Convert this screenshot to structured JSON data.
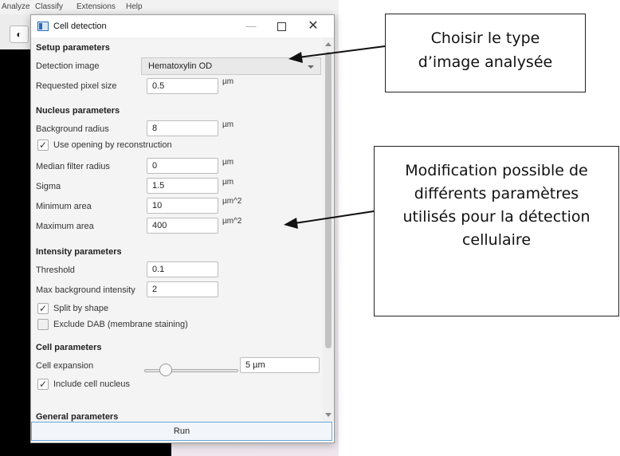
{
  "app": {
    "menu": [
      "Analyze",
      "Classify",
      "Extensions",
      "Help"
    ],
    "toolbar_icon": "contrast-icon"
  },
  "dialog": {
    "title": "Cell detection",
    "controls": {
      "minimize": "—",
      "close": "✕"
    },
    "setup": {
      "heading": "Setup parameters",
      "detection_image_label": "Detection image",
      "detection_image_value": "Hematoxylin OD",
      "pixel_size_label": "Requested pixel size",
      "pixel_size_value": "0.5",
      "pixel_size_unit": "µm"
    },
    "nucleus": {
      "heading": "Nucleus parameters",
      "background_radius_label": "Background radius",
      "background_radius_value": "8",
      "background_radius_unit": "µm",
      "opening_label": "Use opening by reconstruction",
      "opening_checked": true,
      "median_label": "Median filter radius",
      "median_value": "0",
      "median_unit": "µm",
      "sigma_label": "Sigma",
      "sigma_value": "1.5",
      "sigma_unit": "µm",
      "min_area_label": "Minimum area",
      "min_area_value": "10",
      "min_area_unit": "µm^2",
      "max_area_label": "Maximum area",
      "max_area_value": "400",
      "max_area_unit": "µm^2"
    },
    "intensity": {
      "heading": "Intensity parameters",
      "threshold_label": "Threshold",
      "threshold_value": "0.1",
      "max_bg_label": "Max background intensity",
      "max_bg_value": "2",
      "split_label": "Split by shape",
      "split_checked": true,
      "exclude_dab_label": "Exclude DAB (membrane staining)",
      "exclude_dab_checked": false
    },
    "cell": {
      "heading": "Cell parameters",
      "expansion_label": "Cell expansion",
      "expansion_value": "5 µm",
      "expansion_fraction": 0.16,
      "include_nucleus_label": "Include cell nucleus",
      "include_nucleus_checked": true
    },
    "general": {
      "heading": "General parameters"
    },
    "run_label": "Run"
  },
  "annotations": {
    "callout1_lines": [
      "Choisir le type",
      "d’image analysée"
    ],
    "callout2_lines": [
      "Modification possible de",
      "différents paramètres",
      "utilisés pour la détection",
      "cellulaire"
    ]
  }
}
